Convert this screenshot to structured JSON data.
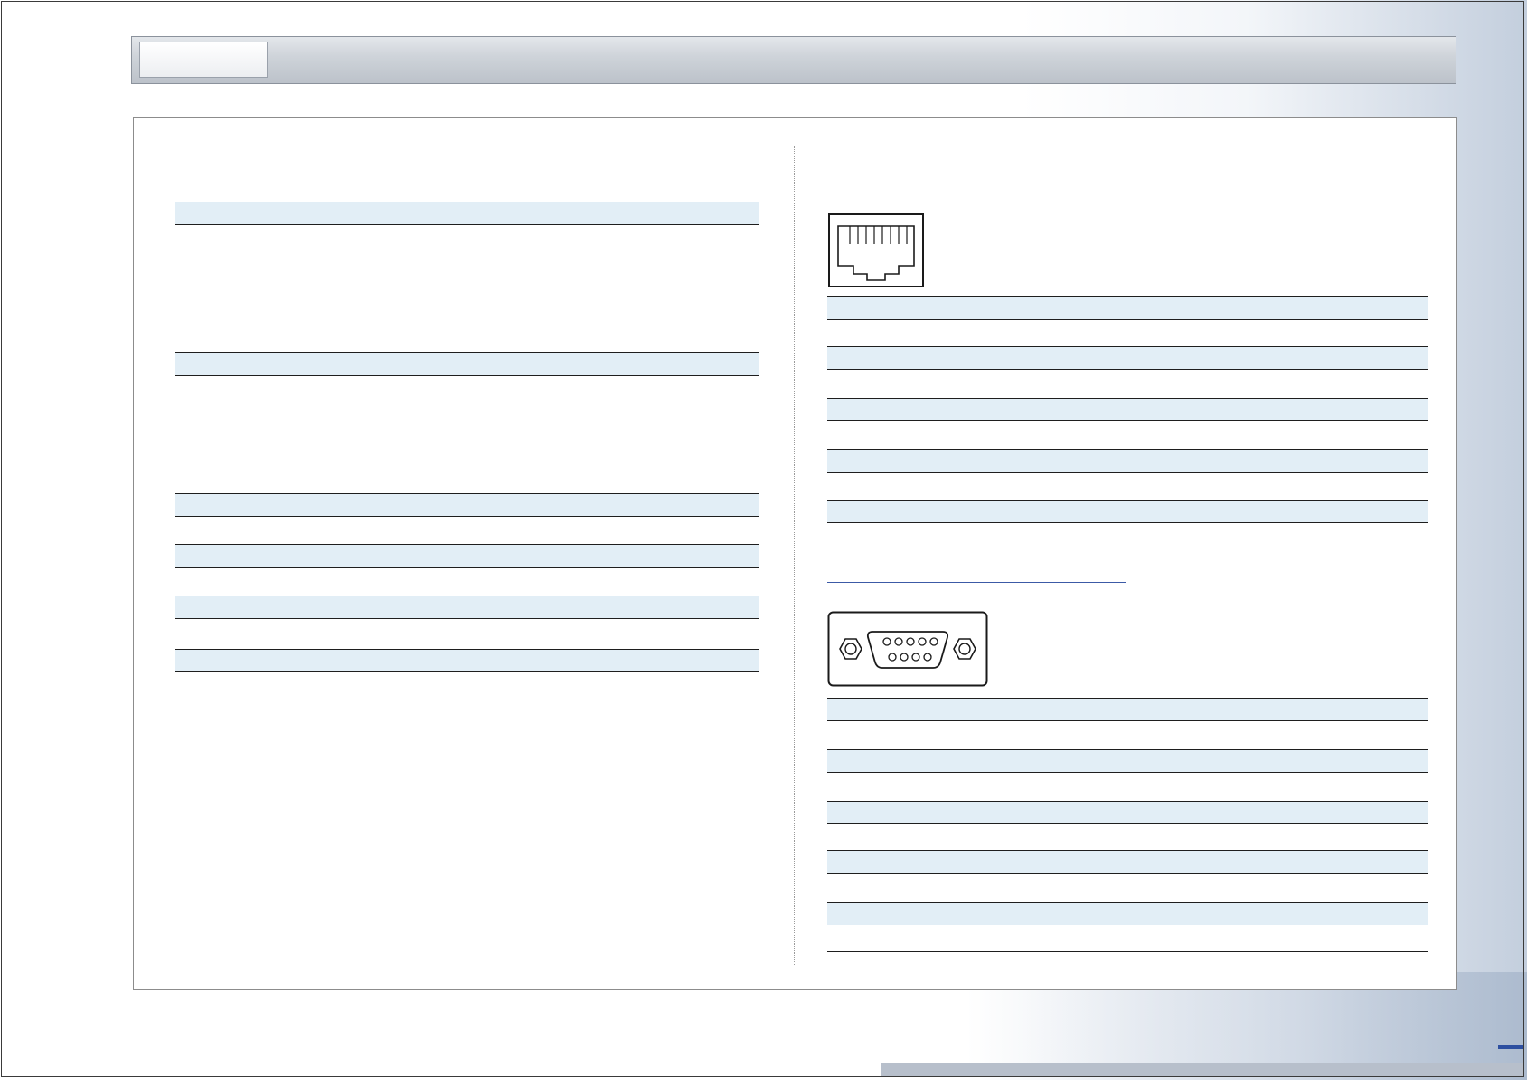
{
  "header": {
    "tab_label": ""
  },
  "left": {
    "section_title": "",
    "rows": [
      "",
      "",
      "",
      "",
      "",
      ""
    ]
  },
  "right": {
    "rj45": {
      "section_title": "",
      "icon": "rj45-port-icon",
      "rows": [
        "",
        "",
        "",
        "",
        ""
      ]
    },
    "db9": {
      "section_title": "",
      "icon": "db9-serial-port-icon",
      "rows": [
        "",
        "",
        "",
        "",
        ""
      ]
    }
  },
  "colors": {
    "accent": "#3c5aa6",
    "row_fill": "#e2eef6",
    "rule": "#1e1e1e"
  }
}
